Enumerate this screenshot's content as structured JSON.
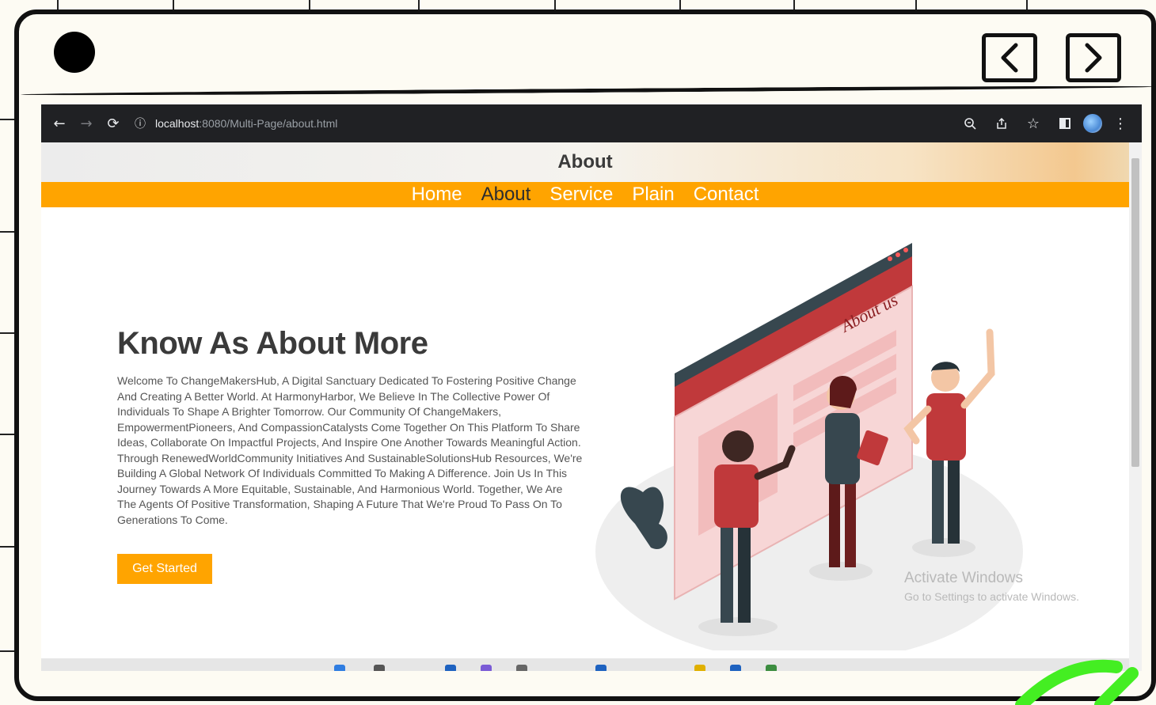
{
  "window": {
    "back_icon": "chevron-left-icon",
    "forward_icon": "chevron-right-icon"
  },
  "browser": {
    "url_host": "localhost",
    "url_path": ":8080/Multi-Page/about.html",
    "info_icon": "ⓘ"
  },
  "site": {
    "header_title": "About",
    "nav": [
      {
        "label": "Home",
        "active": false
      },
      {
        "label": "About",
        "active": true
      },
      {
        "label": "Service",
        "active": false
      },
      {
        "label": "Plain",
        "active": false
      },
      {
        "label": "Contact",
        "active": false
      }
    ],
    "accent_color": "#ffa400"
  },
  "hero": {
    "title": "Know As About More",
    "body": "Welcome To ChangeMakersHub, A Digital Sanctuary Dedicated To Fostering Positive Change And Creating A Better World. At HarmonyHarbor, We Believe In The Collective Power Of Individuals To Shape A Brighter Tomorrow. Our Community Of ChangeMakers, EmpowermentPioneers, And CompassionCatalysts Come Together On This Platform To Share Ideas, Collaborate On Impactful Projects, And Inspire One Another Towards Meaningful Action. Through RenewedWorldCommunity Initiatives And SustainableSolutionsHub Resources, We're Building A Global Network Of Individuals Committed To Making A Difference. Join Us In This Journey Towards A More Equitable, Sustainable, And Harmonious World. Together, We Are The Agents Of Positive Transformation, Shaping A Future That We're Proud To Pass On To Generations To Come.",
    "cta_label": "Get Started",
    "illustration_caption": "About us"
  },
  "watermark": {
    "title": "Activate Windows",
    "subtitle": "Go to Settings to activate Windows."
  }
}
